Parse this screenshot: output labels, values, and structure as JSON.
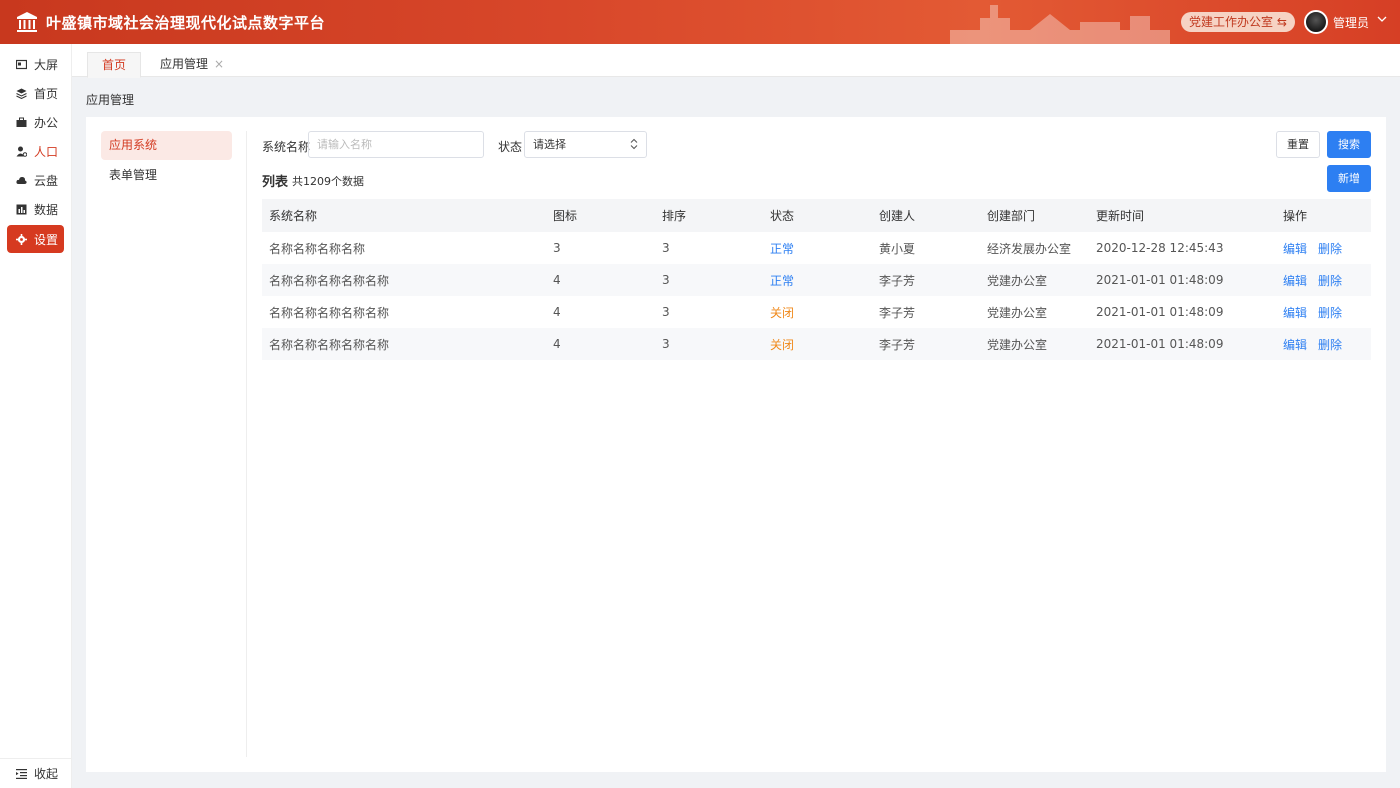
{
  "header": {
    "title": "叶盛镇市域社会治理现代化试点数字平台",
    "office_button": "党建工作办公室 ⇆",
    "user_name": "管理员"
  },
  "sidebar": {
    "items": [
      {
        "label": "大屏",
        "icon": "screen-icon"
      },
      {
        "label": "首页",
        "icon": "layers-icon"
      },
      {
        "label": "办公",
        "icon": "briefcase-icon"
      },
      {
        "label": "人口",
        "icon": "person-icon"
      },
      {
        "label": "云盘",
        "icon": "cloud-icon"
      },
      {
        "label": "数据",
        "icon": "chart-icon"
      },
      {
        "label": "设置",
        "icon": "gear-icon"
      }
    ],
    "collapse_label": "收起"
  },
  "tabs": {
    "home": "首页",
    "app": "应用管理",
    "close": "×"
  },
  "breadcrumb": "应用管理",
  "submenu": [
    "应用系统",
    "表单管理"
  ],
  "filters": {
    "name_label": "系统名称",
    "name_placeholder": "请输入名称",
    "status_label": "状态",
    "status_value": "请选择"
  },
  "buttons": {
    "reset": "重置",
    "search": "搜索",
    "add": "新增"
  },
  "list": {
    "title": "列表",
    "count": "共1209个数据"
  },
  "table": {
    "headers": [
      "系统名称",
      "图标",
      "排序",
      "状态",
      "创建人",
      "创建部门",
      "更新时间",
      "操作"
    ],
    "rows": [
      {
        "name": "名称名称名称名称",
        "icon": "3",
        "order": "3",
        "status": "正常",
        "creator": "黄小夏",
        "dept": "经济发展办公室",
        "time": "2020-12-28 12:45:43",
        "edit": "编辑",
        "del": "删除"
      },
      {
        "name": "名称名称名称名称名称",
        "icon": "4",
        "order": "3",
        "status": "正常",
        "creator": "李子芳",
        "dept": "党建办公室",
        "time": "2021-01-01 01:48:09",
        "edit": "编辑",
        "del": "删除"
      },
      {
        "name": "名称名称名称名称名称",
        "icon": "4",
        "order": "3",
        "status": "关闭",
        "creator": "李子芳",
        "dept": "党建办公室",
        "time": "2021-01-01 01:48:09",
        "edit": "编辑",
        "del": "删除"
      },
      {
        "name": "名称名称名称名称名称",
        "icon": "4",
        "order": "3",
        "status": "关闭",
        "creator": "李子芳",
        "dept": "党建办公室",
        "time": "2021-01-01 01:48:09",
        "edit": "编辑",
        "del": "删除"
      }
    ]
  },
  "colors": {
    "brand": "#d63a20",
    "primary": "#2d7ff2",
    "closed": "#f08a1c"
  }
}
